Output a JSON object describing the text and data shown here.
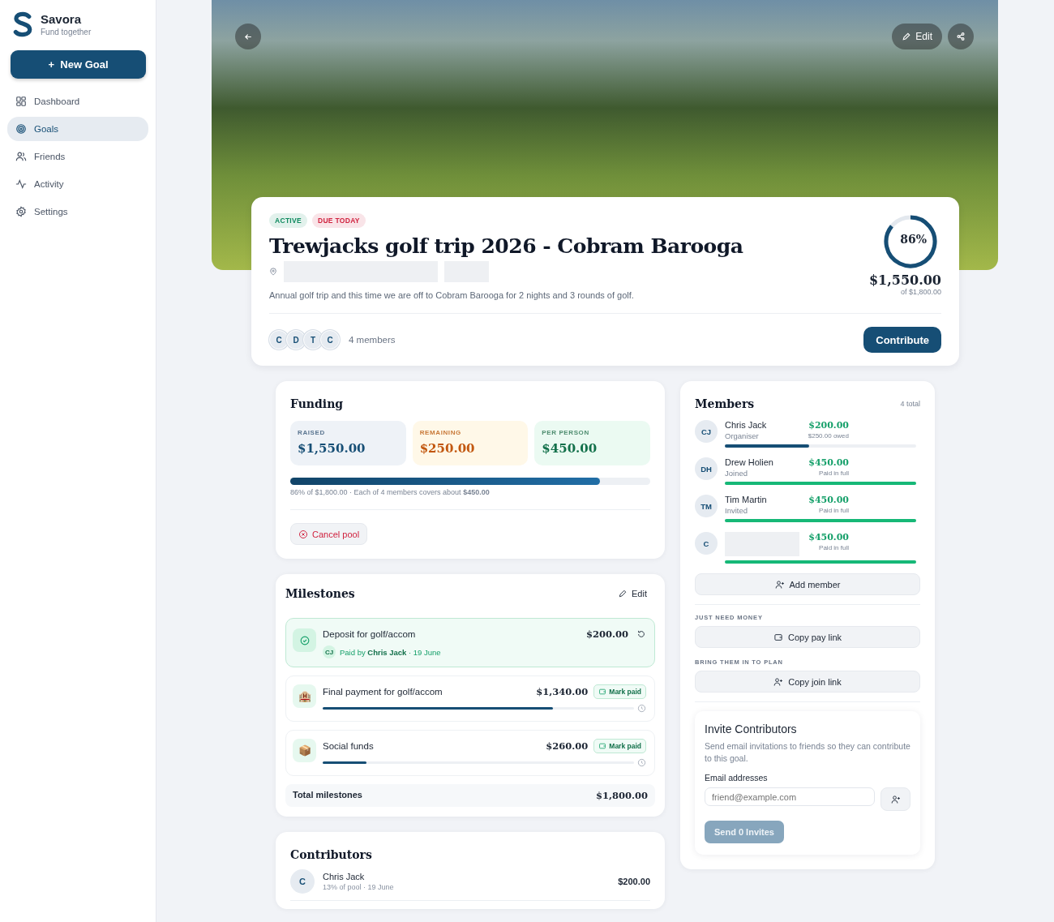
{
  "brand": {
    "name": "Savora",
    "tagline": "Fund together"
  },
  "new_goal_button": {
    "icon": "+",
    "label": "New Goal"
  },
  "sidebar": {
    "items": [
      {
        "label": "Dashboard",
        "selected": false
      },
      {
        "label": "Goals",
        "selected": true
      },
      {
        "label": "Friends",
        "selected": false
      },
      {
        "label": "Activity",
        "selected": false
      },
      {
        "label": "Settings",
        "selected": false
      }
    ]
  },
  "hero": {
    "edit_label": "Edit"
  },
  "goal": {
    "badges": [
      {
        "label": "ACTIVE",
        "color": "#0f8a5f"
      },
      {
        "label": "DUE TODAY",
        "color": "#d0223f"
      }
    ],
    "title": "Trewjacks golf trip 2026 - Cobram Barooga",
    "description": "Annual golf trip and this time we are off to Cobram Barooga for 2 nights and 3 rounds of golf.",
    "progress": {
      "level": 0.86,
      "percent": "86%",
      "raised": "$1,550.00",
      "target": "of $1,800.00"
    },
    "avatars": [
      "C",
      "D",
      "T",
      "C"
    ],
    "members_count": "4 members",
    "contribute_label": "Contribute"
  },
  "funding": {
    "title": "Funding",
    "stats": [
      {
        "label": "RAISED",
        "value": "$1,550.00",
        "kind": "raised"
      },
      {
        "label": "REMAINING",
        "value": "$250.00",
        "kind": "remaining"
      },
      {
        "label": "PER PERSON",
        "value": "$450.00",
        "kind": "per_person"
      }
    ],
    "level": 0.86,
    "summary": "86% of $1,800.00 · Each of 4 members covers about **$450.00**",
    "cancel_label": "Cancel pool"
  },
  "milestones": {
    "title": "Milestones",
    "edit_label": "Edit",
    "items": [
      {
        "name": "Deposit for golf/accom",
        "amount": "$200.00",
        "paid": true,
        "payer_initials": "CJ",
        "paid_by": "Paid by **Chris Jack** · 19 June"
      },
      {
        "name": "Final payment for golf/accom",
        "amount": "$1,340.00",
        "paid": false,
        "icon": "🏨",
        "level": 0.74,
        "action": "Mark paid"
      },
      {
        "name": "Social funds",
        "amount": "$260.00",
        "paid": false,
        "icon": "📦",
        "level": 0.14,
        "action": "Mark paid"
      }
    ],
    "total_label": "Total milestones",
    "total": "$1,800.00"
  },
  "contributors": {
    "title": "Contributors",
    "items": [
      {
        "initial": "C",
        "name": "Chris Jack",
        "detail": "13% of pool · 19 June",
        "amount": "$200.00"
      }
    ]
  },
  "members": {
    "title": "Members",
    "total": "4 total",
    "items": [
      {
        "initials": "CJ",
        "name": "Chris Jack",
        "role": "Organiser",
        "amount": "$200.00",
        "note": "$250.00 owed",
        "level": 0.44
      },
      {
        "initials": "DH",
        "name": "Drew Holien",
        "role": "Joined",
        "amount": "$450.00",
        "note": "Paid in full",
        "level": 1
      },
      {
        "initials": "TM",
        "name": "Tim Martin",
        "role": "Invited",
        "amount": "$450.00",
        "note": "Paid in full",
        "level": 1
      },
      {
        "initials": "C",
        "amount": "$450.00",
        "note": "Paid in full",
        "level": 1
      }
    ],
    "add_label": "Add member",
    "pay_heading": "JUST NEED MONEY",
    "pay_label": "Copy pay link",
    "join_heading": "BRING THEM IN TO PLAN",
    "join_label": "Copy join link"
  },
  "invite": {
    "title": "Invite Contributors",
    "text": "Send email invitations to friends so they can contribute to this goal.",
    "field_label": "Email addresses",
    "placeholder": "friend@example.com",
    "send_label": "Send 0 Invites",
    "send_disabled": true
  }
}
